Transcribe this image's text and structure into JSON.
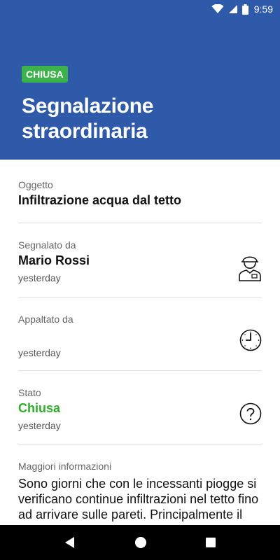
{
  "status_bar": {
    "time": "9:59"
  },
  "header": {
    "badge": "CHIUSA",
    "title": "Segnalazione straordinaria",
    "colors": {
      "background": "#2f5aaa",
      "badge": "#3cb34a"
    }
  },
  "fields": {
    "oggetto": {
      "label": "Oggetto",
      "value": "Infiltrazione acqua dal tetto"
    },
    "segnalato": {
      "label": "Segnalato da",
      "value": "Mario Rossi",
      "date": "yesterday",
      "icon": "worker-avatar-icon"
    },
    "appaltato": {
      "label": "Appaltato da",
      "value": "",
      "date": "yesterday",
      "icon": "clock-icon"
    },
    "stato": {
      "label": "Stato",
      "value": "Chiusa",
      "date": "yesterday",
      "icon": "question-icon",
      "color": "#2fae2a"
    },
    "info": {
      "label": "Maggiori informazioni",
      "text": "Sono giorni che con le incessanti piogge si verificano continue infiltrazioni nel tetto fino ad arrivare sulle pareti. Principalmente il"
    }
  },
  "nav_bar": {
    "back": "back-icon",
    "home": "home-icon",
    "recents": "recents-icon"
  }
}
